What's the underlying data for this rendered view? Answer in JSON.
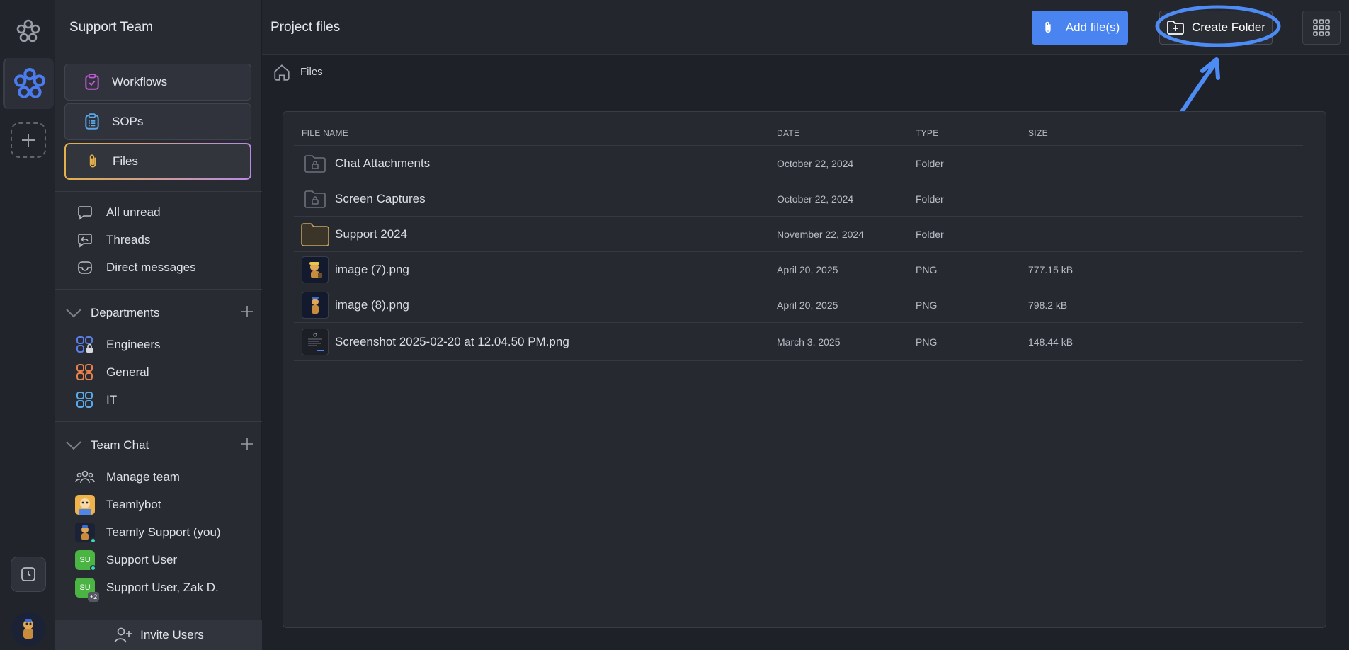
{
  "sidebar": {
    "team_title": "Support Team",
    "nav": [
      {
        "label": "Workflows"
      },
      {
        "label": "SOPs"
      },
      {
        "label": "Files"
      }
    ],
    "quick": [
      {
        "label": "All unread"
      },
      {
        "label": "Threads"
      },
      {
        "label": "Direct messages"
      }
    ],
    "departments": {
      "title": "Departments",
      "items": [
        {
          "label": "Engineers"
        },
        {
          "label": "General"
        },
        {
          "label": "IT"
        }
      ]
    },
    "team_chat": {
      "title": "Team Chat",
      "items": [
        {
          "label": "Manage team"
        },
        {
          "label": "Teamlybot"
        },
        {
          "label": "Teamly Support (you)"
        },
        {
          "label": "Support User",
          "initials": "SU"
        },
        {
          "label": "Support User, Zak D.",
          "initials": "SU",
          "extra": "+2"
        }
      ]
    },
    "invite_label": "Invite Users"
  },
  "header": {
    "title": "Project files",
    "add_files_label": "Add file(s)",
    "create_folder_label": "Create Folder"
  },
  "breadcrumb": {
    "current": "Files"
  },
  "table": {
    "columns": {
      "name": "FILE NAME",
      "date": "DATE",
      "type": "TYPE",
      "size": "SIZE"
    },
    "rows": [
      {
        "name": "Chat Attachments",
        "date": "October 22, 2024",
        "type": "Folder",
        "size": ""
      },
      {
        "name": "Screen Captures",
        "date": "October 22, 2024",
        "type": "Folder",
        "size": ""
      },
      {
        "name": "Support 2024",
        "date": "November 22, 2024",
        "type": "Folder",
        "size": ""
      },
      {
        "name": "image (7).png",
        "date": "April 20, 2025",
        "type": "PNG",
        "size": "777.15 kB"
      },
      {
        "name": "image (8).png",
        "date": "April 20, 2025",
        "type": "PNG",
        "size": "798.2 kB"
      },
      {
        "name": "Screenshot 2025-02-20 at 12.04.50 PM.png",
        "date": "March 3, 2025",
        "type": "PNG",
        "size": "148.44 kB"
      }
    ]
  },
  "colors": {
    "accent_blue": "#4a84f0",
    "annotation_blue": "#4d8bf5",
    "folder_tan": "#c8a760",
    "online_teal": "#3bd4c1",
    "user_green": "#4bb543"
  }
}
